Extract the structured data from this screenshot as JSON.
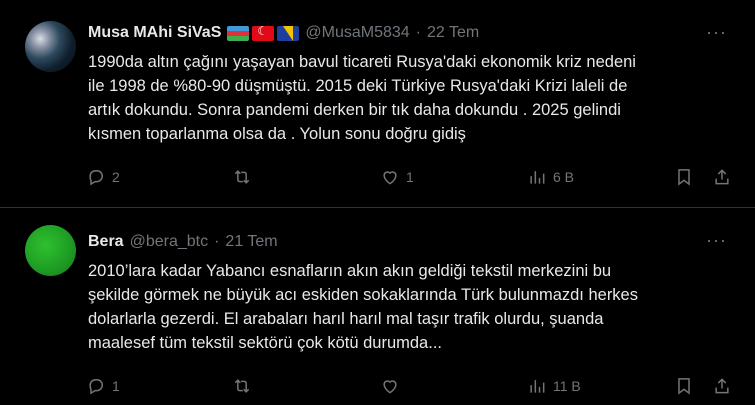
{
  "tweets": [
    {
      "name": "Musa MAhi SiVaS",
      "flags": [
        "azerbaijan-flag",
        "turkey-flag",
        "bosnia-flag"
      ],
      "handle": "@MusaM5834",
      "dot": "·",
      "date": "22 Tem",
      "lines": [
        "1990da altın çağını yaşayan bavul ticareti Rusya'daki ekonomik kriz nedeni",
        "ile 1998 de %80-90  düşmüştü. 2015 deki Türkiye Rusya'daki Krizi laleli de",
        "artık dokundu. Sonra pandemi derken bir tık daha dokundu . 2025 gelindi",
        "kısmen toparlanma olsa da . Yolun sonu doğru gidiş"
      ],
      "replies": "2",
      "reposts": "",
      "likes": "1",
      "views": "6 B"
    },
    {
      "name": "Bera",
      "handle": "@bera_btc",
      "dot": "·",
      "date": "21 Tem",
      "lines": [
        "2010’lara kadar Yabancı esnafların akın akın geldiği  tekstil merkezini bu",
        "şekilde görmek ne büyük acı eskiden sokaklarında Türk bulunmazdı herkes",
        "dolarlarla gezerdi. El arabaları harıl harıl mal taşır trafik olurdu, şuanda",
        "maalesef tüm tekstil sektörü çok kötü durumda..."
      ],
      "replies": "1",
      "reposts": "",
      "likes": "",
      "views": "11 B"
    }
  ],
  "more_label": "···"
}
